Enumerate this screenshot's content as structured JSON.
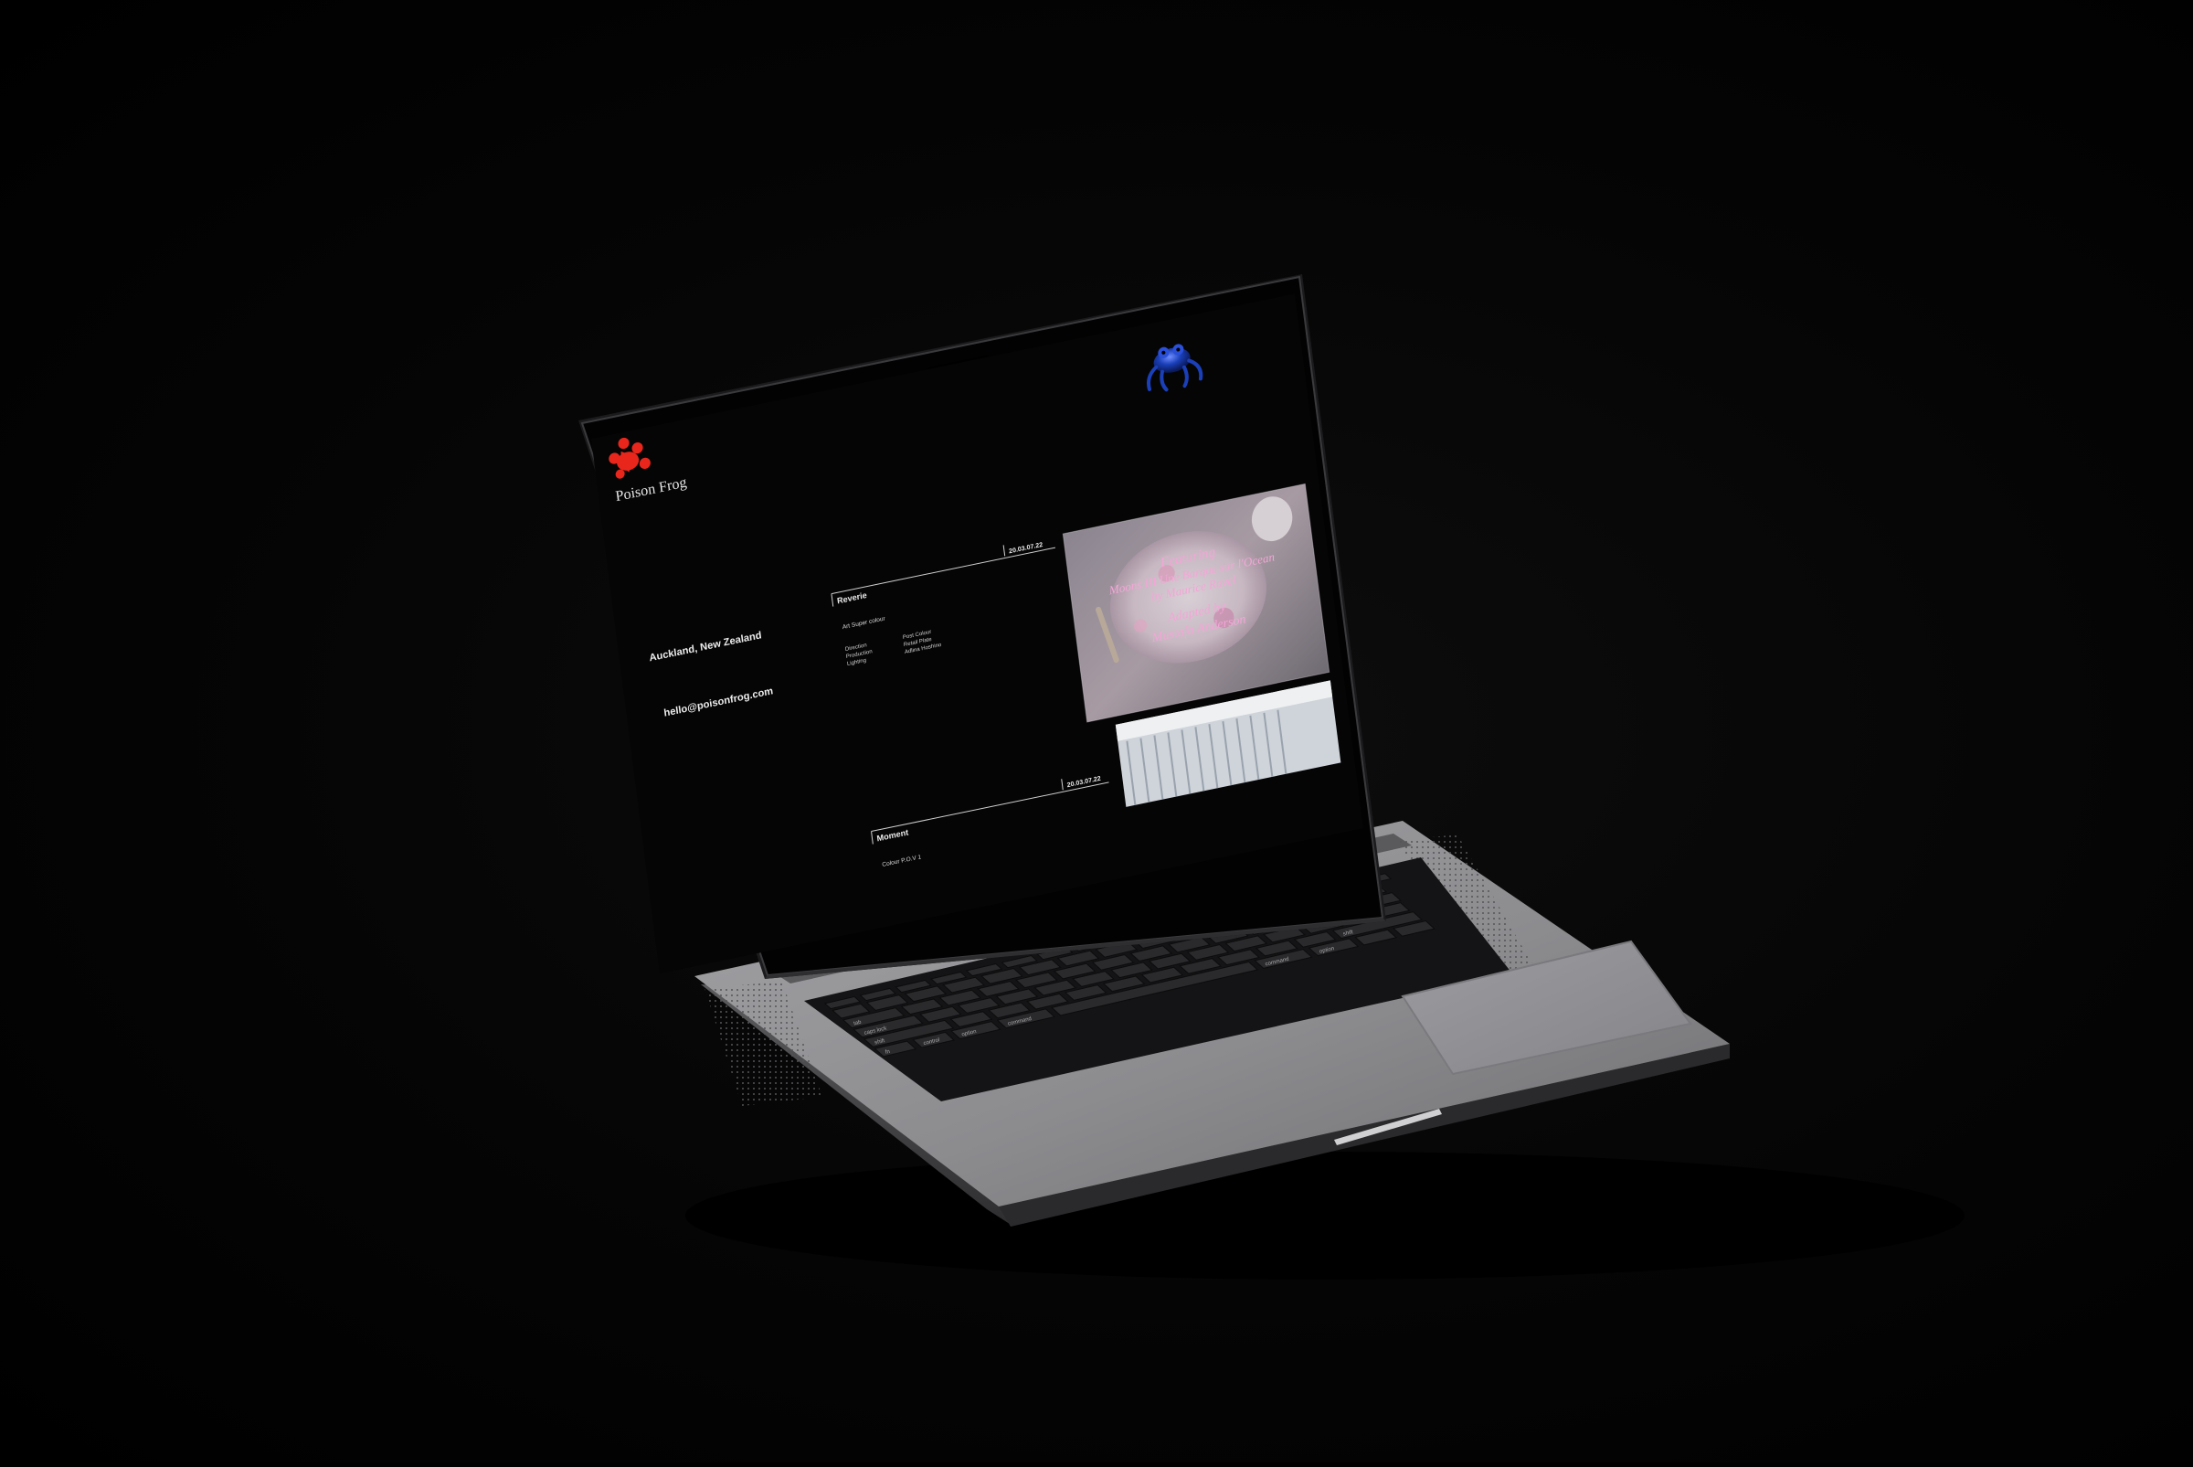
{
  "site": {
    "logo_text": "Poison Frog",
    "location": "Auckland, New Zealand",
    "email": "hello@poisonfrog.com"
  },
  "projects": [
    {
      "title": "Reverie",
      "date": "20.03.07.22",
      "category": "Art Super colour",
      "credits_left": [
        "Direction",
        "Production",
        "Lighting"
      ],
      "credits_right": [
        "Post Colour",
        "Retail Plate",
        "Adlina Hoshino"
      ]
    },
    {
      "title": "Moment",
      "date": "20.03.07.22",
      "category": "Colour P.O.V 1"
    }
  ],
  "featured_image": {
    "lines": [
      "Featuring",
      "Moons III Une Barque sur l'Ocean",
      "by Maurice Ravel",
      "Adapted by",
      "Mustafa Anderson"
    ]
  },
  "keyboard": {
    "labels": {
      "tab": "tab",
      "caps": "caps lock",
      "shift_left": "shift",
      "shift_right": "shift",
      "return": "return",
      "delete": "delete",
      "command": "command",
      "option": "option",
      "control": "control",
      "fn": "fn"
    }
  },
  "colors": {
    "background": "#000000",
    "screen": "#050505",
    "chassis": "#8c8c8e",
    "logo_red": "#e8261c",
    "frog_blue": "#1a3fb8",
    "featured_text": "#f3a6d6"
  }
}
